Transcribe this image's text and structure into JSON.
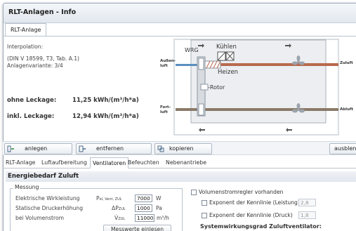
{
  "window": {
    "title": "RLT-Anlagen - Info"
  },
  "top_tab": {
    "label": "RLT-Anlage"
  },
  "info": {
    "interpolation_label": "Interpolation:",
    "norm_ref": "(DIN V 18599, T3, Tab. A.1)",
    "variant": "Anlagenvariante:    3/4",
    "ohne_label": "ohne Leckage:",
    "ohne_value": "11,25 kWh/(m³/h*a)",
    "inkl_label": "inkl. Leckage:",
    "inkl_value": "12,94 kWh/(m³/h*a)"
  },
  "diagram": {
    "wrg": "WRG",
    "kuehlen": "Kühlen",
    "heizen": "Heizen",
    "rotor": "-Rotor",
    "aussen_1": "Außen-",
    "aussen_2": "luft",
    "zuluft": "Zuluft",
    "fort_1": "Fort-",
    "fort_2": "luft",
    "abluft": "Abluft",
    "colors": {
      "supply": "#b86a4e",
      "exhaust": "#8a7a68",
      "outdoor": "#5b8fc0",
      "box": "#cfd3d8"
    }
  },
  "toolbar": {
    "anlegen": "anlegen",
    "entfernen": "entfernen",
    "kopieren": "kopieren",
    "ausblenden": "ausblend"
  },
  "subtabs": [
    "RLT-Anlage",
    "Luftaufbereitung",
    "Ventilatoren",
    "Befeuchten",
    "Nebenantriebe"
  ],
  "section": {
    "title": "Energiebedarf Zuluft"
  },
  "messung": {
    "legend": "Messung",
    "rows": [
      {
        "label": "Elektrische Wirkleistung",
        "symbol": "P",
        "sub": "el, Vent, ZUL",
        "value": "7000",
        "unit": "W"
      },
      {
        "label": "Statische Druckerhöhung",
        "symbol": "ΔP",
        "sub": "ZUL",
        "value": "1000",
        "unit": "Pa"
      },
      {
        "label": "bei Volumenstrom",
        "symbol": "V̇",
        "sub": "ZUL",
        "value": "11000",
        "unit": "m³/h"
      }
    ],
    "button": "Messwerte einlesen"
  },
  "right": {
    "regler": "Volumenstromregler vorhanden",
    "exp_leistung": "Exponent der Kennlinie (Leistung)",
    "exp_leistung_value": "2,8",
    "exp_druck": "Exponent der Kennlinie (Druck)",
    "exp_druck_value": "1,8",
    "systemgrad": "Systemwirkungsgrad Zuluftventilator:"
  }
}
